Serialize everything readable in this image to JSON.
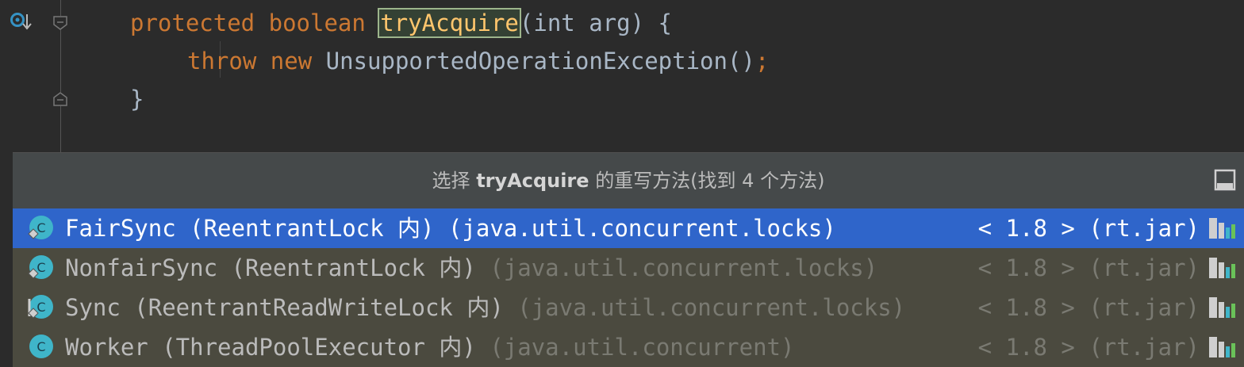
{
  "editor": {
    "lines": [
      {
        "kw1": "protected",
        "kw2": "boolean",
        "method": "tryAcquire",
        "rest": "(int arg) {"
      },
      {
        "kw1": "throw",
        "kw2": "new",
        "rest": "UnsupportedOperationException()",
        "semi": ";"
      },
      {
        "rest": "}"
      }
    ]
  },
  "popup": {
    "title_prefix": "选择",
    "title_method": "tryAcquire",
    "title_suffix": "的重写方法(找到 4 个方法)",
    "items": [
      {
        "name": "FairSync (ReentrantLock 内)",
        "package": " (java.util.concurrent.locks)",
        "library": "< 1.8 > (rt.jar)",
        "selected": true
      },
      {
        "name": "NonfairSync (ReentrantLock 内)",
        "package": " (java.util.concurrent.locks)",
        "library": "< 1.8 > (rt.jar)",
        "selected": false
      },
      {
        "name": "Sync (ReentrantReadWriteLock 内)",
        "package": " (java.util.concurrent.locks)",
        "library": "< 1.8 > (rt.jar)",
        "selected": false
      },
      {
        "name": "Worker (ThreadPoolExecutor 内)",
        "package": " (java.util.concurrent)",
        "library": "< 1.8 > (rt.jar)",
        "selected": false
      }
    ]
  },
  "icons": {
    "override": "override-method-icon",
    "fold": "fold-icon",
    "class": "class-icon",
    "library": "library-jar-icon",
    "pin": "pin-popup-icon"
  },
  "colors": {
    "editor_bg": "#2b2b2b",
    "keyword": "#cc7832",
    "method": "#ffc66d",
    "text": "#a9b7c6",
    "selection": "#2f65ca"
  }
}
